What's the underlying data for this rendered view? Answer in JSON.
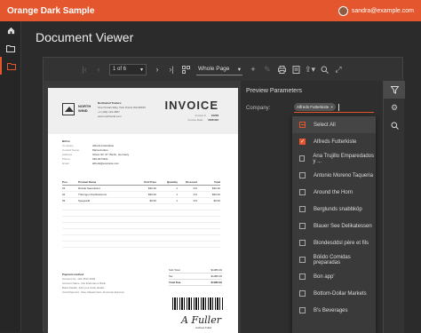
{
  "app": {
    "title": "Orange Dark Sample",
    "user_email": "sandra@example.com",
    "accent": "#e4572e"
  },
  "sidebar": {
    "items": [
      {
        "icon": "home-icon"
      },
      {
        "icon": "folder-icon"
      },
      {
        "icon": "folder-open-icon"
      }
    ]
  },
  "page": {
    "title": "Document Viewer"
  },
  "toolbar": {
    "page_value": "1 of 6",
    "zoom_value": "Whole Page"
  },
  "invoice": {
    "heading": "INVOICE",
    "logo_text": [
      "NORTH",
      "WIND"
    ],
    "company": [
      "Northwind Traders",
      "One Portals Way, Twin Points WA 98156",
      "+1 (100) 123-4567",
      "www.northwind.com"
    ],
    "meta": [
      {
        "k": "Invoice #",
        "v": "10248"
      },
      {
        "k": "Invoice Date",
        "v": "05/21/22"
      }
    ],
    "bill_to_title": "Bill to:",
    "bill_to": [
      {
        "k": "Company",
        "v": "Alfreds Futterkiste"
      },
      {
        "k": "Contact Name",
        "v": "Maria Anders"
      },
      {
        "k": "Address",
        "v": "Obere Str. 57, Berlin, Germany"
      },
      {
        "k": "Phone",
        "v": "030-0074321"
      },
      {
        "k": "Email",
        "v": "alfreds@example.com"
      }
    ],
    "table_headers": [
      "Pos.",
      "Product Name",
      "Unit Price",
      "Quantity",
      "Discount",
      "Total"
    ],
    "rows": [
      [
        "#1",
        "Rössle Sauerkraut",
        "$36.40",
        "1",
        "0%",
        "$36.40"
      ],
      [
        "#2",
        "Thüringer Rostbratwurst",
        "$99.00",
        "1",
        "0%",
        "$99.00"
      ],
      [
        "#3",
        "Spegesild",
        "$9.60",
        "1",
        "0%",
        "$9.60"
      ]
    ],
    "totals": [
      {
        "k": "Sub Total",
        "v": "$1086.00"
      },
      {
        "k": "Tax",
        "v": "$1086.00"
      },
      {
        "k": "Total Due",
        "v": "$1086.00"
      }
    ],
    "payment_title": "Payment method",
    "payment": [
      {
        "k": "Account No",
        "v": "123 4513 4536"
      },
      {
        "k": "Account Name",
        "v": "Idw Endurance Bank"
      },
      {
        "k": "Bank Details",
        "v": "Add your bank details"
      },
      {
        "k": "Card Payment",
        "v": "Visa, MasterCard, American Express"
      }
    ],
    "signature": "A Fuller",
    "signer": "Andrew Fuller"
  },
  "panel": {
    "title": "Preview Parameters",
    "company_label": "Company:",
    "chip": "Alfreds Futterkiste",
    "options": [
      {
        "label": "Select All",
        "state": "partial"
      },
      {
        "label": "Alfreds Futterkiste",
        "state": "checked"
      },
      {
        "label": "Ana Trujillo Emparedados y ...",
        "state": "unchecked"
      },
      {
        "label": "Antonio Moreno Taqueria",
        "state": "unchecked"
      },
      {
        "label": "Around the Horn",
        "state": "unchecked"
      },
      {
        "label": "Berglunds snabbköp",
        "state": "unchecked"
      },
      {
        "label": "Blauer See Delikatessen",
        "state": "unchecked"
      },
      {
        "label": "Blondesddsl père et fils",
        "state": "unchecked"
      },
      {
        "label": "Bólido Comidas preparadas",
        "state": "unchecked"
      },
      {
        "label": "Bon app'",
        "state": "unchecked"
      },
      {
        "label": "Bottom-Dollar Markets",
        "state": "unchecked"
      },
      {
        "label": "B's Beverages",
        "state": "unchecked"
      }
    ]
  },
  "rail": {
    "items": [
      {
        "icon": "filter-icon"
      },
      {
        "icon": "gear-icon"
      },
      {
        "icon": "search-icon"
      }
    ]
  }
}
